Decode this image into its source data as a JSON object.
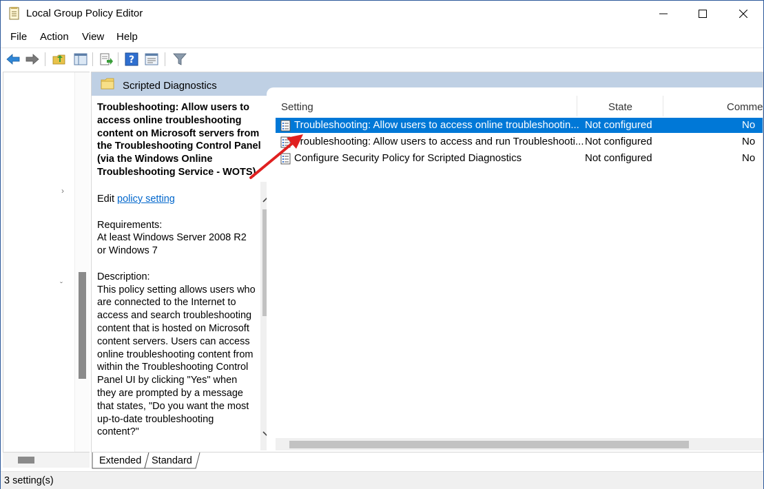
{
  "window": {
    "title": "Local Group Policy Editor"
  },
  "menu": [
    "File",
    "Action",
    "View",
    "Help"
  ],
  "toolbar": [
    "back-icon",
    "forward-icon",
    "up-folder-icon",
    "show-hide-tree-icon",
    "export-list-icon",
    "help-icon",
    "properties-icon",
    "filter-icon"
  ],
  "folder": {
    "title": "Scripted Diagnostics"
  },
  "description": {
    "title": "Troubleshooting: Allow users to access online troubleshooting content on Microsoft servers from the Troubleshooting Control Panel (via the Windows Online Troubleshooting Service - WOTS)",
    "edit_prefix": "Edit ",
    "edit_link": "policy setting ",
    "requirements_label": "Requirements:",
    "requirements_text": "At least Windows Server 2008 R2 or Windows 7",
    "description_label": "Description:",
    "description_text": "This policy setting allows users who are connected to the Internet to access and search troubleshooting content that is hosted on Microsoft content servers. Users can access online troubleshooting content from within the Troubleshooting Control Panel UI by clicking \"Yes\" when they are prompted by a message that states, \"Do you want the most up-to-date troubleshooting content?\""
  },
  "columns": {
    "setting": "Setting",
    "state": "State",
    "comment": "Comment"
  },
  "rows": [
    {
      "setting": "Troubleshooting: Allow users to access online troubleshootin...",
      "state": "Not configured",
      "comment": "No",
      "selected": true
    },
    {
      "setting": "Troubleshooting: Allow users to access and run Troubleshooti...",
      "state": "Not configured",
      "comment": "No",
      "selected": false
    },
    {
      "setting": "Configure Security Policy for Scripted Diagnostics",
      "state": "Not configured",
      "comment": "No",
      "selected": false
    }
  ],
  "tabs": {
    "extended": "Extended",
    "standard": "Standard"
  },
  "status": "3 setting(s)",
  "colors": {
    "selection": "#0078d7",
    "link": "#0066cc",
    "annotation": "#e02020",
    "header_band": "#bfd0e4"
  }
}
